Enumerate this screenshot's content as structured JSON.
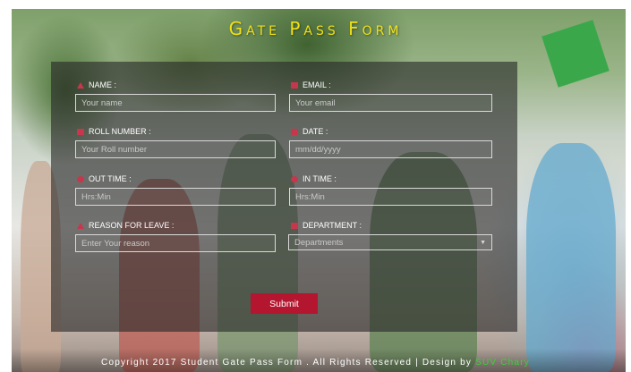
{
  "title": "Gate Pass Form",
  "colors": {
    "accent": "#b5162f",
    "title": "#f0e018",
    "brand": "#3ad13a"
  },
  "fields": [
    {
      "label": "NAME :",
      "icon": "user-icon",
      "placeholder": "Your name"
    },
    {
      "label": "EMAIL :",
      "icon": "envelope-icon",
      "placeholder": "Your email"
    },
    {
      "label": "ROLL NUMBER :",
      "icon": "id-card-icon",
      "placeholder": "Your Roll number"
    },
    {
      "label": "DATE :",
      "icon": "calendar-icon",
      "placeholder": "mm/dd/yyyy"
    },
    {
      "label": "OUT TIME :",
      "icon": "clock-icon",
      "placeholder": "Hrs:Min"
    },
    {
      "label": "IN TIME :",
      "icon": "clock-icon",
      "placeholder": "Hrs:Min"
    },
    {
      "label": "REASON FOR LEAVE :",
      "icon": "home-icon",
      "placeholder": "Enter Your reason"
    },
    {
      "label": "DEPARTMENT :",
      "icon": "building-icon",
      "selected": "Departments"
    }
  ],
  "submit_label": "Submit",
  "footer": {
    "text": "Copyright 2017 Student Gate Pass Form . All Rights Reserved | Design by",
    "brand": "SUV Chary"
  }
}
